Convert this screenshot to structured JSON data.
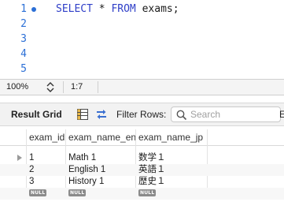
{
  "editor": {
    "lines": [
      {
        "num": "1",
        "keyword1": "SELECT",
        "middle": " * ",
        "keyword2": "FROM",
        "rest": " exams;"
      },
      {
        "num": "2"
      },
      {
        "num": "3"
      },
      {
        "num": "4"
      },
      {
        "num": "5"
      }
    ]
  },
  "status": {
    "zoom": "100%",
    "cursor": "1:7"
  },
  "toolbar": {
    "result_grid_label": "Result Grid",
    "filter_label": "Filter Rows:",
    "search_placeholder": "Search",
    "overflow_label": "E"
  },
  "grid": {
    "columns": [
      "exam_id",
      "exam_name_en",
      "exam_name_jp"
    ],
    "rows": [
      [
        "1",
        "Math 1",
        "数学１"
      ],
      [
        "2",
        "English 1",
        "英語１"
      ],
      [
        "3",
        "History 1",
        "歴史１"
      ]
    ],
    "null_label": "NULL"
  },
  "colors": {
    "accent": "#2b6fd6",
    "keyword": "#2f3fc8",
    "null_badge": "#8b8b8b"
  }
}
